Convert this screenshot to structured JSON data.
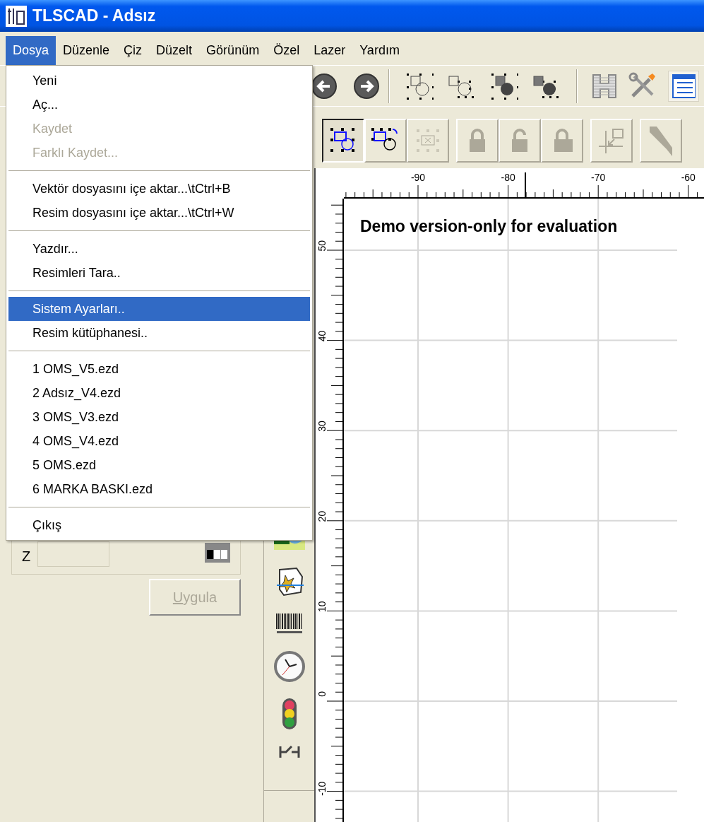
{
  "window": {
    "title": "TLSCAD - Adsız"
  },
  "menu_bar": [
    {
      "label": "Dosya",
      "selected": true
    },
    {
      "label": "Düzenle",
      "selected": false
    },
    {
      "label": "Çiz",
      "selected": false
    },
    {
      "label": "Düzelt",
      "selected": false
    },
    {
      "label": "Görünüm",
      "selected": false
    },
    {
      "label": "Özel",
      "selected": false
    },
    {
      "label": "Lazer",
      "selected": false
    },
    {
      "label": "Yardım",
      "selected": false
    }
  ],
  "file_menu": [
    {
      "kind": "item",
      "label": "Yeni",
      "disabled": false,
      "selected": false
    },
    {
      "kind": "item",
      "label": "Aç...",
      "disabled": false,
      "selected": false
    },
    {
      "kind": "item",
      "label": "Kaydet",
      "disabled": true,
      "selected": false
    },
    {
      "kind": "item",
      "label": "Farklı Kaydet...",
      "disabled": true,
      "selected": false
    },
    {
      "kind": "separator"
    },
    {
      "kind": "item",
      "label": "Vektör dosyasını içe aktar...\\tCtrl+B",
      "disabled": false,
      "selected": false
    },
    {
      "kind": "item",
      "label": "Resim dosyasını içe aktar...\\tCtrl+W",
      "disabled": false,
      "selected": false
    },
    {
      "kind": "separator"
    },
    {
      "kind": "item",
      "label": "Yazdır...",
      "disabled": false,
      "selected": false
    },
    {
      "kind": "item",
      "label": "Resimleri Tara..",
      "disabled": false,
      "selected": false
    },
    {
      "kind": "separator"
    },
    {
      "kind": "item",
      "label": "Sistem Ayarları..",
      "disabled": false,
      "selected": true
    },
    {
      "kind": "item",
      "label": "Resim kütüphanesi..",
      "disabled": false,
      "selected": false
    },
    {
      "kind": "separator"
    },
    {
      "kind": "item",
      "label": "1 OMS_V5.ezd",
      "disabled": false,
      "selected": false
    },
    {
      "kind": "item",
      "label": "2 Adsız_V4.ezd",
      "disabled": false,
      "selected": false
    },
    {
      "kind": "item",
      "label": "3 OMS_V3.ezd",
      "disabled": false,
      "selected": false
    },
    {
      "kind": "item",
      "label": "4 OMS_V4.ezd",
      "disabled": false,
      "selected": false
    },
    {
      "kind": "item",
      "label": "5 OMS.ezd",
      "disabled": false,
      "selected": false
    },
    {
      "kind": "item",
      "label": "6 MARKA BASKI.ezd",
      "disabled": false,
      "selected": false
    },
    {
      "kind": "separator"
    },
    {
      "kind": "item",
      "label": "Çıkış",
      "disabled": false,
      "selected": false
    }
  ],
  "toolbar_1": [
    {
      "kind": "back"
    },
    {
      "kind": "forward"
    },
    {
      "kind": "separator"
    },
    {
      "kind": "select-outline"
    },
    {
      "kind": "select-outline-small"
    },
    {
      "kind": "select-solid"
    },
    {
      "kind": "select-solid-small"
    },
    {
      "kind": "separator"
    },
    {
      "kind": "hatch"
    },
    {
      "kind": "tools"
    },
    {
      "kind": "list"
    }
  ],
  "toolbar_2": [
    {
      "kind": "group",
      "pressed": true,
      "disabled": false
    },
    {
      "kind": "group-rotate",
      "pressed": false,
      "disabled": false
    },
    {
      "kind": "ungroup",
      "pressed": false,
      "disabled": true
    },
    {
      "kind": "gap"
    },
    {
      "kind": "lock",
      "pressed": false,
      "disabled": true
    },
    {
      "kind": "unlock",
      "pressed": false,
      "disabled": true
    },
    {
      "kind": "lock-partial",
      "pressed": false,
      "disabled": true
    },
    {
      "kind": "gap"
    },
    {
      "kind": "origin",
      "pressed": false,
      "disabled": true
    },
    {
      "kind": "gap"
    },
    {
      "kind": "pen",
      "pressed": false,
      "disabled": true
    }
  ],
  "left_panel": {
    "z_field": {
      "label": "Z"
    },
    "apply_button": {
      "label": "Uygula",
      "disabled": true
    }
  },
  "tool_strip": [
    {
      "kind": "image"
    },
    {
      "kind": "star-map"
    },
    {
      "kind": "barcode"
    },
    {
      "kind": "clock"
    },
    {
      "kind": "traffic-light"
    },
    {
      "kind": "i-beam"
    }
  ],
  "horizontal_ruler": {
    "labels": [
      "-90",
      "-80",
      "-70",
      "-60"
    ]
  },
  "vertical_ruler": {
    "labels": [
      "50",
      "40",
      "30",
      "20",
      "10",
      "0",
      "-10"
    ]
  },
  "canvas": {
    "notice": "Demo version-only for evaluation"
  }
}
